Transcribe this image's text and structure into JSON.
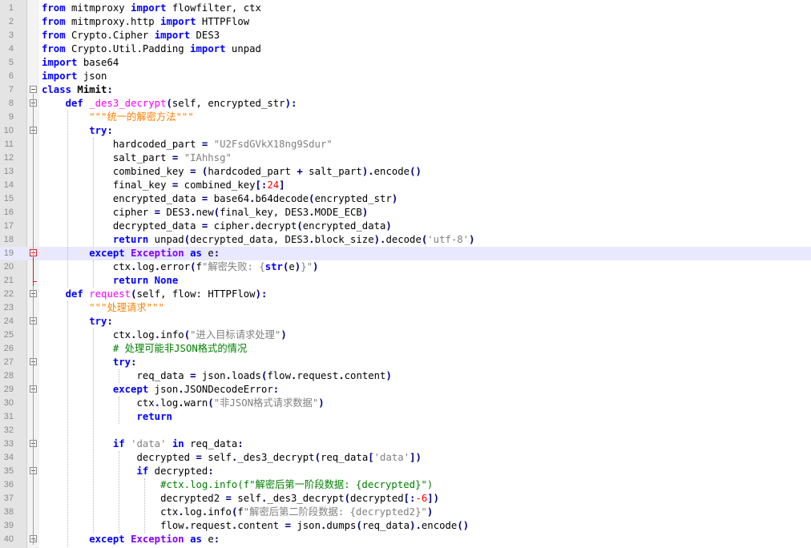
{
  "editor": {
    "lines": [
      [
        [
          "kw",
          "from"
        ],
        [
          "t",
          " mitmproxy "
        ],
        [
          "kw",
          "import"
        ],
        [
          "t",
          " flowfilter, ctx"
        ]
      ],
      [
        [
          "kw",
          "from"
        ],
        [
          "t",
          " mitmproxy.http "
        ],
        [
          "kw",
          "import"
        ],
        [
          "t",
          " HTTPFlow"
        ]
      ],
      [
        [
          "kw",
          "from"
        ],
        [
          "t",
          " Crypto.Cipher "
        ],
        [
          "kw",
          "import"
        ],
        [
          "t",
          " DES3"
        ]
      ],
      [
        [
          "kw",
          "from"
        ],
        [
          "t",
          " Crypto.Util.Padding "
        ],
        [
          "kw",
          "import"
        ],
        [
          "t",
          " unpad"
        ]
      ],
      [
        [
          "kw",
          "import"
        ],
        [
          "t",
          " base64"
        ]
      ],
      [
        [
          "kw",
          "import"
        ],
        [
          "t",
          " json"
        ]
      ],
      [
        [
          "kw",
          "class"
        ],
        [
          "cls",
          " Mimit"
        ],
        [
          "op",
          ":"
        ]
      ],
      [
        [
          "t",
          "    "
        ],
        [
          "kw",
          "def"
        ],
        [
          "t",
          " "
        ],
        [
          "fn",
          "_des3_decrypt"
        ],
        [
          "op",
          "("
        ],
        [
          "t",
          "self, encrypted_str"
        ],
        [
          "op",
          "):"
        ]
      ],
      [
        [
          "t",
          "        "
        ],
        [
          "doc",
          "\"\"\"统一的解密方法\"\"\""
        ]
      ],
      [
        [
          "t",
          "        "
        ],
        [
          "kw",
          "try"
        ],
        [
          "op",
          ":"
        ]
      ],
      [
        [
          "t",
          "            hardcoded_part "
        ],
        [
          "op",
          "="
        ],
        [
          "t",
          " "
        ],
        [
          "str",
          "\"U2FsdGVkX18ng9Sdur\""
        ]
      ],
      [
        [
          "t",
          "            salt_part "
        ],
        [
          "op",
          "="
        ],
        [
          "t",
          " "
        ],
        [
          "str",
          "\"IAhhsg\""
        ]
      ],
      [
        [
          "t",
          "            combined_key "
        ],
        [
          "op",
          "="
        ],
        [
          "t",
          " "
        ],
        [
          "op",
          "("
        ],
        [
          "t",
          "hardcoded_part "
        ],
        [
          "op",
          "+"
        ],
        [
          "t",
          " salt_part"
        ],
        [
          "op",
          ")."
        ],
        [
          "t",
          "encode"
        ],
        [
          "op",
          "()"
        ]
      ],
      [
        [
          "t",
          "            final_key "
        ],
        [
          "op",
          "="
        ],
        [
          "t",
          " combined_key"
        ],
        [
          "op",
          "[:"
        ],
        [
          "num",
          "24"
        ],
        [
          "op",
          "]"
        ]
      ],
      [
        [
          "t",
          "            encrypted_data "
        ],
        [
          "op",
          "="
        ],
        [
          "t",
          " base64"
        ],
        [
          "op",
          "."
        ],
        [
          "t",
          "b64decode"
        ],
        [
          "op",
          "("
        ],
        [
          "t",
          "encrypted_str"
        ],
        [
          "op",
          ")"
        ]
      ],
      [
        [
          "t",
          "            cipher "
        ],
        [
          "op",
          "="
        ],
        [
          "t",
          " DES3"
        ],
        [
          "op",
          "."
        ],
        [
          "t",
          "new"
        ],
        [
          "op",
          "("
        ],
        [
          "t",
          "final_key, DES3"
        ],
        [
          "op",
          "."
        ],
        [
          "t",
          "MODE_ECB"
        ],
        [
          "op",
          ")"
        ]
      ],
      [
        [
          "t",
          "            decrypted_data "
        ],
        [
          "op",
          "="
        ],
        [
          "t",
          " cipher"
        ],
        [
          "op",
          "."
        ],
        [
          "t",
          "decrypt"
        ],
        [
          "op",
          "("
        ],
        [
          "t",
          "encrypted_data"
        ],
        [
          "op",
          ")"
        ]
      ],
      [
        [
          "t",
          "            "
        ],
        [
          "kw",
          "return"
        ],
        [
          "t",
          " unpad"
        ],
        [
          "op",
          "("
        ],
        [
          "t",
          "decrypted_data, DES3"
        ],
        [
          "op",
          "."
        ],
        [
          "t",
          "block_size"
        ],
        [
          "op",
          ")."
        ],
        [
          "t",
          "decode"
        ],
        [
          "op",
          "("
        ],
        [
          "str",
          "'utf-8'"
        ],
        [
          "op",
          ")"
        ]
      ],
      [
        [
          "t",
          "        "
        ],
        [
          "kw",
          "except"
        ],
        [
          "t",
          " "
        ],
        [
          "exc",
          "Exception"
        ],
        [
          "t",
          " "
        ],
        [
          "kw",
          "as"
        ],
        [
          "t",
          " e"
        ],
        [
          "op",
          ":"
        ]
      ],
      [
        [
          "t",
          "            ctx"
        ],
        [
          "op",
          "."
        ],
        [
          "t",
          "log"
        ],
        [
          "op",
          "."
        ],
        [
          "t",
          "error"
        ],
        [
          "op",
          "("
        ],
        [
          "t",
          "f"
        ],
        [
          "str",
          "\"解密失败: {"
        ],
        [
          "kw",
          "str"
        ],
        [
          "op",
          "("
        ],
        [
          "t",
          "e"
        ],
        [
          "op",
          ")"
        ],
        [
          "str",
          "}\""
        ],
        [
          "op",
          ")"
        ]
      ],
      [
        [
          "t",
          "            "
        ],
        [
          "kw",
          "return"
        ],
        [
          "t",
          " "
        ],
        [
          "kw",
          "None"
        ]
      ],
      [
        [
          "t",
          "    "
        ],
        [
          "kw",
          "def"
        ],
        [
          "t",
          " "
        ],
        [
          "fn",
          "request"
        ],
        [
          "op",
          "("
        ],
        [
          "t",
          "self, flow: HTTPFlow"
        ],
        [
          "op",
          "):"
        ]
      ],
      [
        [
          "t",
          "        "
        ],
        [
          "doc",
          "\"\"\"处理请求\"\"\""
        ]
      ],
      [
        [
          "t",
          "        "
        ],
        [
          "kw",
          "try"
        ],
        [
          "op",
          ":"
        ]
      ],
      [
        [
          "t",
          "            ctx"
        ],
        [
          "op",
          "."
        ],
        [
          "t",
          "log"
        ],
        [
          "op",
          "."
        ],
        [
          "t",
          "info"
        ],
        [
          "op",
          "("
        ],
        [
          "str",
          "\"进入目标请求处理\""
        ],
        [
          "op",
          ")"
        ]
      ],
      [
        [
          "t",
          "            "
        ],
        [
          "cmt",
          "# 处理可能非JSON格式的情况"
        ]
      ],
      [
        [
          "t",
          "            "
        ],
        [
          "kw",
          "try"
        ],
        [
          "op",
          ":"
        ]
      ],
      [
        [
          "t",
          "                req_data "
        ],
        [
          "op",
          "="
        ],
        [
          "t",
          " json"
        ],
        [
          "op",
          "."
        ],
        [
          "t",
          "loads"
        ],
        [
          "op",
          "("
        ],
        [
          "t",
          "flow"
        ],
        [
          "op",
          "."
        ],
        [
          "t",
          "request"
        ],
        [
          "op",
          "."
        ],
        [
          "t",
          "content"
        ],
        [
          "op",
          ")"
        ]
      ],
      [
        [
          "t",
          "            "
        ],
        [
          "kw",
          "except"
        ],
        [
          "t",
          " json"
        ],
        [
          "op",
          "."
        ],
        [
          "t",
          "JSONDecodeError"
        ],
        [
          "op",
          ":"
        ]
      ],
      [
        [
          "t",
          "                ctx"
        ],
        [
          "op",
          "."
        ],
        [
          "t",
          "log"
        ],
        [
          "op",
          "."
        ],
        [
          "t",
          "warn"
        ],
        [
          "op",
          "("
        ],
        [
          "str",
          "\"非JSON格式请求数据\""
        ],
        [
          "op",
          ")"
        ]
      ],
      [
        [
          "t",
          "                "
        ],
        [
          "kw",
          "return"
        ]
      ],
      [
        [
          "t",
          ""
        ]
      ],
      [
        [
          "t",
          "            "
        ],
        [
          "kw",
          "if"
        ],
        [
          "t",
          " "
        ],
        [
          "str",
          "'data'"
        ],
        [
          "t",
          " "
        ],
        [
          "kw",
          "in"
        ],
        [
          "t",
          " req_data"
        ],
        [
          "op",
          ":"
        ]
      ],
      [
        [
          "t",
          "                decrypted "
        ],
        [
          "op",
          "="
        ],
        [
          "t",
          " self"
        ],
        [
          "op",
          "."
        ],
        [
          "t",
          "_des3_decrypt"
        ],
        [
          "op",
          "("
        ],
        [
          "t",
          "req_data"
        ],
        [
          "op",
          "["
        ],
        [
          "str",
          "'data'"
        ],
        [
          "op",
          "])"
        ]
      ],
      [
        [
          "t",
          "                "
        ],
        [
          "kw",
          "if"
        ],
        [
          "t",
          " decrypted"
        ],
        [
          "op",
          ":"
        ]
      ],
      [
        [
          "t",
          "                    "
        ],
        [
          "cmt",
          "#ctx.log.info(f\"解密后第一阶段数据: {decrypted}\")"
        ]
      ],
      [
        [
          "t",
          "                    decrypted2 "
        ],
        [
          "op",
          "="
        ],
        [
          "t",
          " self"
        ],
        [
          "op",
          "."
        ],
        [
          "t",
          "_des3_decrypt"
        ],
        [
          "op",
          "("
        ],
        [
          "t",
          "decrypted"
        ],
        [
          "op",
          "[:"
        ],
        [
          "num",
          "-6"
        ],
        [
          "op",
          "])"
        ]
      ],
      [
        [
          "t",
          "                    ctx"
        ],
        [
          "op",
          "."
        ],
        [
          "t",
          "log"
        ],
        [
          "op",
          "."
        ],
        [
          "t",
          "info"
        ],
        [
          "op",
          "("
        ],
        [
          "t",
          "f"
        ],
        [
          "str",
          "\"解密后第二阶段数据: {decrypted2}\""
        ],
        [
          "op",
          ")"
        ]
      ],
      [
        [
          "t",
          "                    flow"
        ],
        [
          "op",
          "."
        ],
        [
          "t",
          "request"
        ],
        [
          "op",
          "."
        ],
        [
          "t",
          "content "
        ],
        [
          "op",
          "="
        ],
        [
          "t",
          " json"
        ],
        [
          "op",
          "."
        ],
        [
          "t",
          "dumps"
        ],
        [
          "op",
          "("
        ],
        [
          "t",
          "req_data"
        ],
        [
          "op",
          ")."
        ],
        [
          "t",
          "encode"
        ],
        [
          "op",
          "()"
        ]
      ],
      [
        [
          "t",
          "        "
        ],
        [
          "kw",
          "except"
        ],
        [
          "t",
          " "
        ],
        [
          "exc",
          "Exception"
        ],
        [
          "t",
          " "
        ],
        [
          "kw",
          "as"
        ],
        [
          "t",
          " e"
        ],
        [
          "op",
          ":"
        ]
      ]
    ],
    "line_numbers": [
      "1",
      "2",
      "3",
      "4",
      "5",
      "6",
      "7",
      "8",
      "9",
      "10",
      "11",
      "12",
      "13",
      "14",
      "15",
      "16",
      "17",
      "18",
      "19",
      "20",
      "21",
      "22",
      "23",
      "24",
      "25",
      "26",
      "27",
      "28",
      "29",
      "30",
      "31",
      "32",
      "33",
      "34",
      "35",
      "36",
      "37",
      "38",
      "39",
      "40"
    ],
    "current_line": 19,
    "fold_markers": {
      "7": "fold",
      "8": "fold",
      "10": "fold",
      "19": "fold-red",
      "22": "fold",
      "24": "fold",
      "27": "fold",
      "29": "fold",
      "33": "fold",
      "35": "fold",
      "40": "fold"
    },
    "colors": {
      "keyword": "#0000ff",
      "string": "#808080",
      "docstring": "#ff8000",
      "function": "#ff00ff",
      "number": "#ff0000",
      "comment": "#008000",
      "exception": "#8000ff",
      "current_line": "#e8e8ff"
    }
  }
}
